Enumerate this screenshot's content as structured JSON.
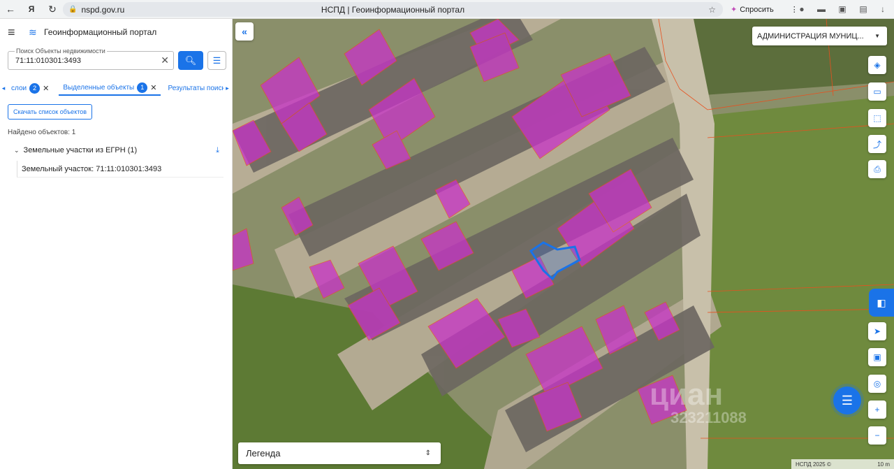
{
  "browser": {
    "url": "nspd.gov.ru",
    "page_title": "НСПД | Геоинформационный портал",
    "ask_label": "Спросить"
  },
  "app": {
    "title": "Геоинформационный портал"
  },
  "search": {
    "label": "Поиск Объекты недвижимости",
    "value": "71:11:010301:3493"
  },
  "tabs": [
    {
      "label": "слои",
      "badge": "2"
    },
    {
      "label": "Выделенные объекты",
      "badge": "1"
    },
    {
      "label": "Результаты поиска"
    }
  ],
  "results": {
    "download_label": "Скачать список объектов",
    "found_label": "Найдено объектов: 1",
    "group_label": "Земельные участки из ЕГРН (1)",
    "item_label": "Земельный участок: 71:11:010301:3493"
  },
  "map": {
    "admin_select": "АДМИНИСТРАЦИЯ МУНИЦ...",
    "legend_label": "Легенда",
    "scale_left": "НСПД 2025 ©",
    "scale_right": "10 m",
    "watermark_1": "циан",
    "watermark_2": "323211088",
    "colors": {
      "parcel_fill": "#c832c8",
      "parcel_border": "#e8501e",
      "selected": "#1a73e8"
    }
  },
  "icons": [
    "back-icon",
    "yandex-icon",
    "reload-icon",
    "lock-icon",
    "bookmark-icon",
    "menu-icon",
    "portal-logo-icon",
    "search-icon",
    "clear-icon",
    "filter-icon",
    "layers-icon",
    "ruler-icon",
    "select-area-icon",
    "share-icon",
    "print-icon",
    "locate-icon",
    "picture-in-picture-icon",
    "gps-icon",
    "zoom-in-icon",
    "zoom-out-icon",
    "chat-icon"
  ]
}
